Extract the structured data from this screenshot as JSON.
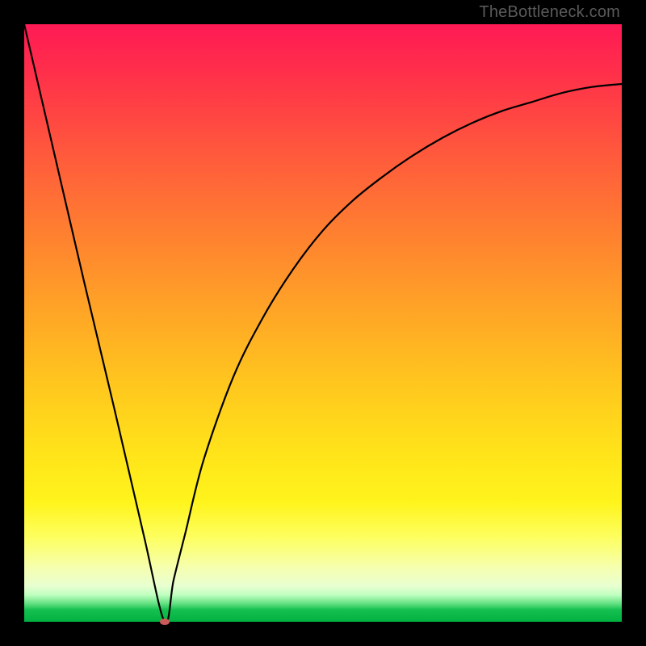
{
  "watermark": "TheBottleneck.com",
  "chart_data": {
    "type": "line",
    "title": "",
    "xlabel": "",
    "ylabel": "",
    "xlim": [
      0,
      100
    ],
    "ylim": [
      0,
      100
    ],
    "grid": false,
    "legend": false,
    "series": [
      {
        "name": "bottleneck-curve",
        "x": [
          0,
          5,
          10,
          15,
          20,
          23.5,
          25,
          27,
          30,
          35,
          40,
          45,
          50,
          55,
          60,
          65,
          70,
          75,
          80,
          85,
          90,
          95,
          100
        ],
        "values": [
          100,
          78.5,
          57,
          36,
          14.5,
          0,
          7,
          15,
          27,
          41,
          51,
          59,
          65.5,
          70.5,
          74.5,
          78,
          81,
          83.5,
          85.5,
          87,
          88.5,
          89.5,
          90
        ]
      }
    ],
    "marker": {
      "x": 23.5,
      "y": 0
    },
    "background_gradient": {
      "top": "#ff1a55",
      "mid_upper": "#ff8030",
      "mid": "#ffe41a",
      "lower": "#f6ffb0",
      "bottom": "#00b040"
    }
  }
}
